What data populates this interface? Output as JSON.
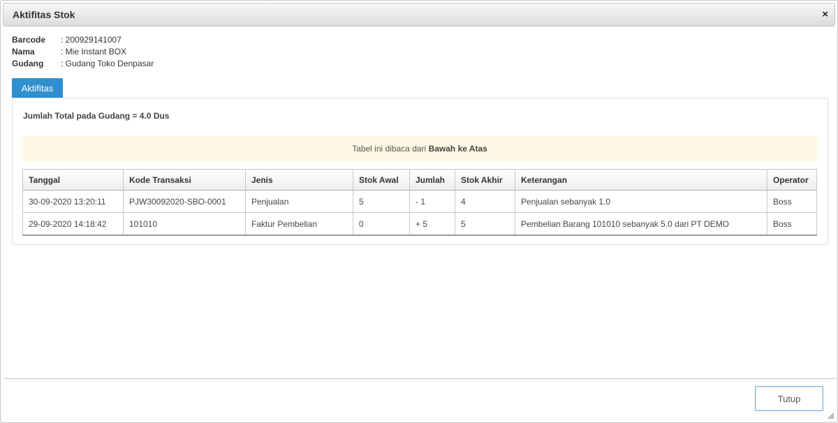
{
  "dialog": {
    "title": "Aktifitas Stok",
    "close_icon": "×"
  },
  "info": [
    {
      "label": "Barcode",
      "value": ": 200929141007"
    },
    {
      "label": "Nama",
      "value": ": Mie Instant BOX"
    },
    {
      "label": "Gudang",
      "value": ": Gudang Toko Denpasar"
    }
  ],
  "tab": {
    "label": "Aktifitas"
  },
  "summary": {
    "total_text": "Jumlah Total pada Gudang = 4.0 Dus"
  },
  "notice": {
    "prefix": "Tabel ini dibaca dari ",
    "emphasis": "Bawah ke Atas"
  },
  "table": {
    "headers": [
      "Tanggal",
      "Kode Transaksi",
      "Jenis",
      "Stok Awal",
      "Jumlah",
      "Stok Akhir",
      "Keterangan",
      "Operator"
    ],
    "rows": [
      [
        "30-09-2020 13:20:11",
        "PJW30092020-SBO-0001",
        "Penjualan",
        "5",
        "- 1",
        "4",
        "Penjualan sebanyak 1.0",
        "Boss"
      ],
      [
        "29-09-2020 14:18:42",
        "101010",
        "Faktur Pembelian",
        "0",
        "+ 5",
        "5",
        "Pembelian Barang 101010 sebanyak 5.0 dari PT DEMO",
        "Boss"
      ]
    ]
  },
  "footer": {
    "close_button": "Tutup"
  }
}
